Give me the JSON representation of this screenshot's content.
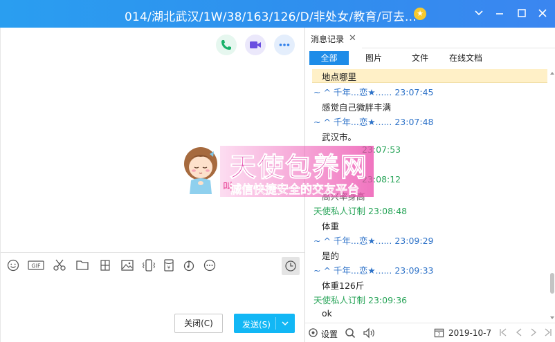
{
  "window": {
    "title": "014/湖北武汉/1W/38/163/126/D/非处女/教育/可去...",
    "controls": [
      "chevron-down-icon",
      "minimize-icon",
      "maximize-icon",
      "close-icon"
    ]
  },
  "chat": {
    "call_buttons": [
      "phone-icon",
      "video-icon",
      "more-icon"
    ],
    "toolbar_icons": [
      "emoji-icon",
      "gif-icon",
      "scissors-icon",
      "folder-icon",
      "image-collage-icon",
      "image-icon",
      "vibrate-icon",
      "redpacket-icon",
      "music-icon",
      "more-circle-icon",
      "clock-icon"
    ],
    "gif_label": "GIF",
    "close_button": "关闭(C)",
    "send_button": "发送(S)"
  },
  "history": {
    "tab_label": "消息记录",
    "filters": [
      "全部",
      "图片",
      "文件",
      "在线文档"
    ],
    "active_filter": "全部",
    "messages": [
      {
        "kind": "text",
        "text": "地点哪里",
        "highlighted": true
      },
      {
        "kind": "sender",
        "name": "~ ^ 千年...恋★......",
        "time": "23:07:45",
        "side": "b"
      },
      {
        "kind": "text",
        "text": "感觉自己微胖丰满"
      },
      {
        "kind": "sender",
        "name": "~ ^ 千年...恋★......",
        "time": "23:07:48",
        "side": "b"
      },
      {
        "kind": "text",
        "text": "武汉市。"
      },
      {
        "kind": "sender",
        "name": "",
        "time": "23:07:53",
        "side": "a"
      },
      {
        "kind": "text",
        "text": ""
      },
      {
        "kind": "sender",
        "name": "",
        "time": "23:08:12",
        "side": "a"
      },
      {
        "kind": "text",
        "text": "高兴率身高"
      },
      {
        "kind": "sender",
        "name": "天使私人订制",
        "time": "23:08:48",
        "side": "a"
      },
      {
        "kind": "text",
        "text": "体重"
      },
      {
        "kind": "sender",
        "name": "~ ^ 千年...恋★......",
        "time": "23:09:29",
        "side": "b"
      },
      {
        "kind": "text",
        "text": "是的"
      },
      {
        "kind": "sender",
        "name": "~ ^ 千年...恋★......",
        "time": "23:09:33",
        "side": "b"
      },
      {
        "kind": "text",
        "text": "体重126斤"
      },
      {
        "kind": "sender",
        "name": "天使私人订制",
        "time": "23:09:36",
        "side": "a"
      },
      {
        "kind": "text",
        "text": "ok"
      }
    ],
    "footer": {
      "settings_label": "设置",
      "date": "2019-10-7",
      "calendar_day": "7"
    }
  },
  "watermark": {
    "title": "天使包养网",
    "subtitle": "诚信快捷安全的交友平台",
    "hint": "叫"
  },
  "colors": {
    "titlebar": "#2f8fee",
    "accent": "#12b7f5",
    "filter_active": "#1e8ce8",
    "sender_b": "#2d72c8",
    "sender_a": "#2aa55a",
    "highlight": "#fff0c7"
  }
}
